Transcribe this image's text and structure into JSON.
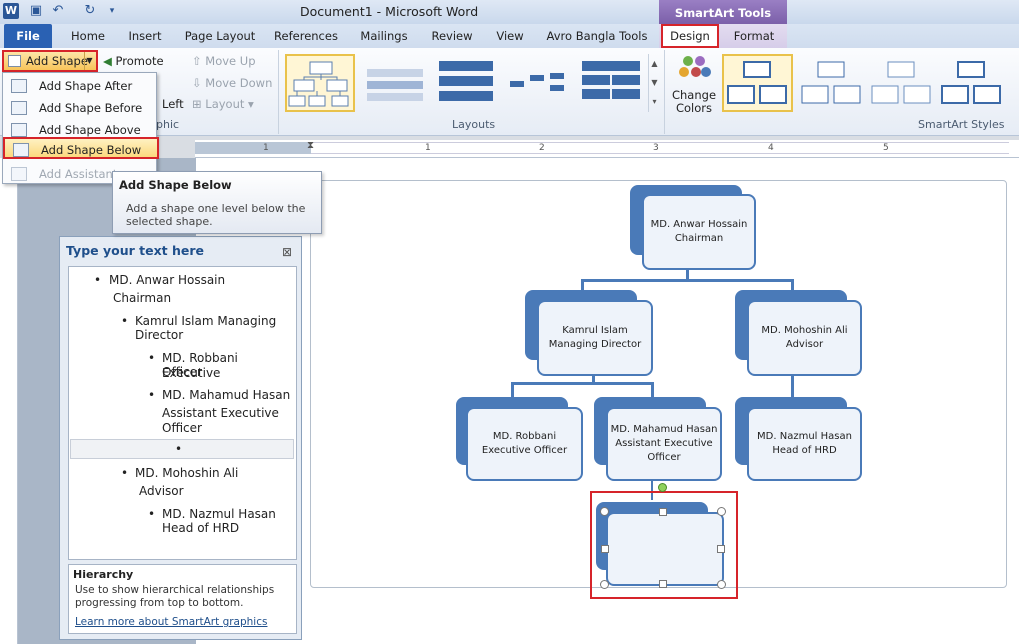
{
  "window": {
    "title": "Document1 - Microsoft Word",
    "context_tab_group": "SmartArt Tools"
  },
  "tabs": [
    "File",
    "Home",
    "Insert",
    "Page Layout",
    "References",
    "Mailings",
    "Review",
    "View",
    "Avro Bangla Tools",
    "Design",
    "Format"
  ],
  "ribbon": {
    "add_shape": "Add Shape",
    "promote": "Promote",
    "move_up": "Move Up",
    "move_down": "Move Down",
    "left_partial": "Left",
    "layout": "Layout",
    "group_graphic_partial": "phic",
    "layouts_label": "Layouts",
    "change_colors_1": "Change",
    "change_colors_2": "Colors",
    "smartart_styles_label": "SmartArt Styles"
  },
  "add_shape_menu": {
    "items": [
      "Add Shape After",
      "Add Shape Before",
      "Add Shape Above",
      "Add Shape Below",
      "Add Assistant"
    ]
  },
  "tooltip": {
    "title": "Add Shape Below",
    "body": "Add a shape one level below the selected shape."
  },
  "ruler": {
    "marks": [
      "1",
      "1",
      "2",
      "3",
      "4",
      "5"
    ]
  },
  "text_pane": {
    "title": "Type your text here",
    "items": [
      "MD. Anwar Hossain",
      "Chairman",
      "Kamrul Islam Managing",
      "Director",
      "MD. Robbani Executive",
      "Officer",
      "MD. Mahamud Hasan",
      "Assistant Executive",
      "Officer",
      "MD. Mohoshin Ali",
      "Advisor",
      "MD. Nazmul Hasan",
      "Head of HRD"
    ],
    "bullet": "•",
    "hier_title": "Hierarchy",
    "hier_desc": "Use to show hierarchical relationships progressing from top to bottom.",
    "hier_link": "Learn more about SmartArt graphics"
  },
  "org_chart": {
    "root": "MD. Anwar Hossain Chairman",
    "n1": "Kamrul Islam Managing Director",
    "n2": "MD. Mohoshin Ali Advisor",
    "n3": "MD. Robbani Executive Officer",
    "n4": "MD. Mahamud Hasan Assistant Executive Officer",
    "n5": "MD. Nazmul Hasan Head of HRD",
    "n6": ""
  },
  "colors": {
    "accent": "#4a7ab8",
    "highlight_border": "#d6242a",
    "file_tab": "#2a61b3"
  }
}
